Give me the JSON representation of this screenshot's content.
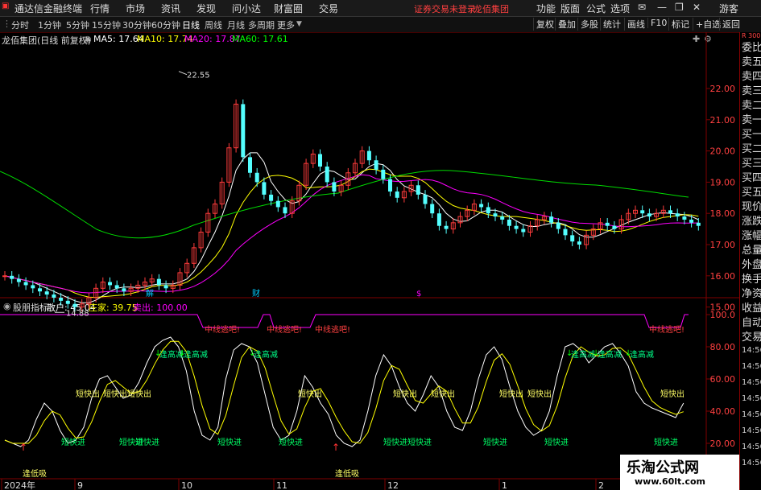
{
  "menu": {
    "app_title": "通达信金融终端",
    "items": [
      "行情",
      "市场",
      "资讯",
      "发现",
      "问小达",
      "财富圈",
      "交易"
    ],
    "status": "证券交易未登录",
    "stock_name": "龙佰集团",
    "right_items": [
      "功能",
      "版面",
      "公式",
      "选项"
    ],
    "user": "游客"
  },
  "toolbar": {
    "periods": [
      "分时",
      "1分钟",
      "5分钟",
      "15分钟",
      "30分钟",
      "60分钟",
      "日线",
      "周线",
      "月线",
      "多周期",
      "更多"
    ],
    "selected": "日线",
    "right_buttons": [
      "复权",
      "叠加",
      "多股",
      "统计",
      "画线",
      "F10",
      "标记",
      "+自选",
      "返回"
    ]
  },
  "main_chart": {
    "title": "龙佰集团(日线 前复权)",
    "ma_labels": [
      {
        "text": "MA5: 17.64",
        "color": "#ffffff"
      },
      {
        "text": "MA10: 17.74",
        "color": "#ffff00"
      },
      {
        "text": "MA20: 17.87",
        "color": "#ff00ff"
      },
      {
        "text": "MA60: 17.61",
        "color": "#00ff00"
      }
    ],
    "y_ticks": [
      "22.00",
      "21.00",
      "20.00",
      "19.00",
      "18.00",
      "17.00",
      "16.00",
      "15.00"
    ],
    "high_label": "22.55",
    "low_label": "14.88",
    "markers": [
      "解",
      "财",
      "$"
    ]
  },
  "indicator": {
    "name": "股朋指标",
    "labels": [
      {
        "text": "散户: 45.04",
        "color": "#ffffff"
      },
      {
        "text": "庄家: 39.75",
        "color": "#ffff00"
      },
      {
        "text": "卖出: 100.00",
        "color": "#ff00ff"
      }
    ],
    "y_ticks": [
      "100.0",
      "80.00",
      "60.00",
      "40.00",
      "20.00"
    ],
    "sell_signals": [
      "中线逃吧!",
      "中线逃吧!",
      "中线逃吧!",
      "中线逃吧!"
    ],
    "high_reduce": [
      "逢高减",
      "逢高减",
      "逢高减",
      "逢高减",
      "逢高减",
      "逢高减"
    ],
    "short_out": [
      "短快出",
      "短快出",
      "短快出",
      "短快出",
      "短快出",
      "短快出",
      "短快出",
      "短快出",
      "短快出"
    ],
    "short_in": [
      "短快进",
      "短快进",
      "短快进",
      "短快进",
      "短快进",
      "短快进",
      "短快进",
      "短快进",
      "短快进",
      "短快进"
    ],
    "low_buy": [
      "逢低吸",
      "逢低吸"
    ]
  },
  "x_axis": {
    "labels": [
      "2024年",
      "9",
      "10",
      "11",
      "12",
      "1",
      "2"
    ]
  },
  "right_panel": {
    "labels": [
      "委比",
      "卖五",
      "卖四",
      "卖三",
      "卖二",
      "卖一",
      "买一",
      "买二",
      "买三",
      "买四",
      "买五",
      "现价",
      "涨跌",
      "涨幅",
      "总量",
      "外盘",
      "换手",
      "净资",
      "收益",
      "自动",
      "交易"
    ],
    "times": [
      "14:56",
      "14:56",
      "14:56",
      "14:56",
      "14:56",
      "14:56",
      "14:56",
      "14:56"
    ],
    "header": "R 300"
  },
  "watermark": {
    "title": "乐淘公式网",
    "url": "www.60lt.com"
  }
}
